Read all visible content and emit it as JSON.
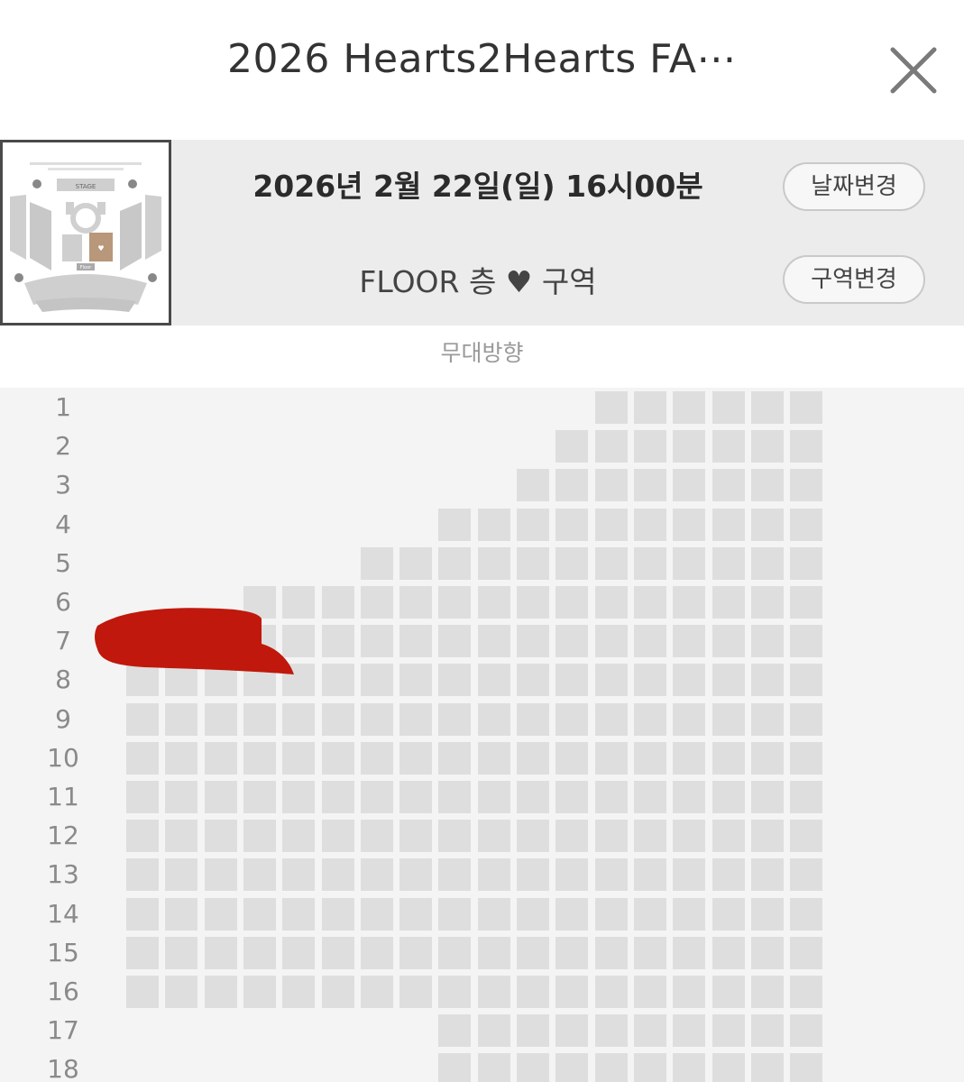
{
  "header": {
    "title": "2026 Hearts2Hearts FA⋯",
    "close_icon": "close-icon"
  },
  "info": {
    "date": "2026년 2월 22일(일) 16시00분",
    "zone": "FLOOR 층 ♥ 구역",
    "change_date_label": "날짜변경",
    "change_zone_label": "구역변경",
    "thumbnail_stage_label": "STAGE",
    "thumbnail_floor_label": "Floor"
  },
  "seat_map": {
    "stage_direction": "무대방향",
    "seat_color": "#dedede",
    "highlight_color": "#b8977a",
    "scribble_color": "#c0180c",
    "rows": [
      {
        "label": "1",
        "first_seat_col": 12
      },
      {
        "label": "2",
        "first_seat_col": 11
      },
      {
        "label": "3",
        "first_seat_col": 10
      },
      {
        "label": "4",
        "first_seat_col": 8
      },
      {
        "label": "5",
        "first_seat_col": 6
      },
      {
        "label": "6",
        "first_seat_col": 3
      },
      {
        "label": "7",
        "first_seat_col": 0
      },
      {
        "label": "8",
        "first_seat_col": 0
      },
      {
        "label": "9",
        "first_seat_col": 0
      },
      {
        "label": "10",
        "first_seat_col": 0
      },
      {
        "label": "11",
        "first_seat_col": 0
      },
      {
        "label": "12",
        "first_seat_col": 0
      },
      {
        "label": "13",
        "first_seat_col": 0
      },
      {
        "label": "14",
        "first_seat_col": 0
      },
      {
        "label": "15",
        "first_seat_col": 0
      },
      {
        "label": "16",
        "first_seat_col": 0
      },
      {
        "label": "17",
        "first_seat_col": 8
      },
      {
        "label": "18",
        "first_seat_col": 8
      }
    ],
    "columns_total": 18
  }
}
